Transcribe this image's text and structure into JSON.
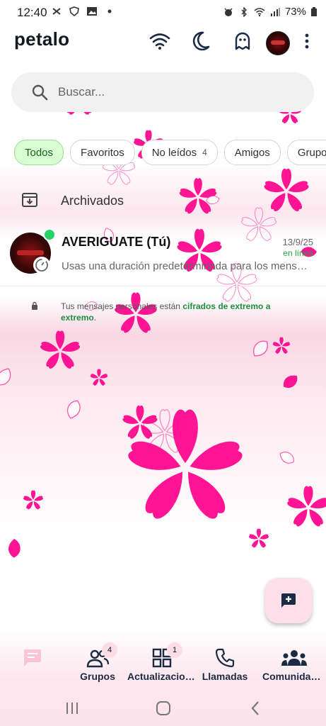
{
  "status_bar": {
    "time": "12:40",
    "battery": "73%"
  },
  "header": {
    "title": "petalo"
  },
  "search": {
    "placeholder": "Buscar..."
  },
  "filters": [
    {
      "label": "Todos",
      "count": ""
    },
    {
      "label": "Favoritos",
      "count": ""
    },
    {
      "label": "No leídos",
      "count": "4"
    },
    {
      "label": "Amigos",
      "count": ""
    },
    {
      "label": "Grupos",
      "count": ""
    }
  ],
  "archived": {
    "label": "Archivados"
  },
  "chat": {
    "name": "AVERIGUATE (Tú)",
    "date": "13/9/25",
    "status": "en línea",
    "preview": "Usas una duración predeterminada para los mensajes temporales"
  },
  "encryption": {
    "text": "Tus mensajes personales están ",
    "link": "cifrados de extremo a extremo",
    "end": "."
  },
  "bottom_nav": [
    {
      "label": "",
      "badge": ""
    },
    {
      "label": "Grupos",
      "badge": "4"
    },
    {
      "label": "Actualizaciones",
      "badge": "1"
    },
    {
      "label": "Llamadas",
      "badge": ""
    },
    {
      "label": "Comunidades",
      "badge": ""
    }
  ],
  "colors": {
    "accent": "#25d366",
    "petal": "#ff1493",
    "brand_text": "#111b21",
    "link": "#1e8e3e"
  }
}
